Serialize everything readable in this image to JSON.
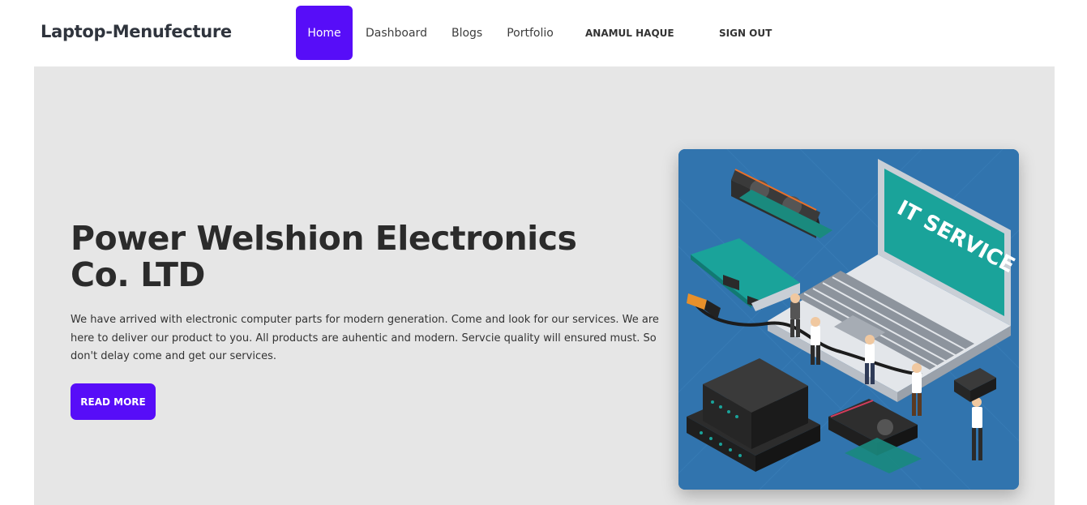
{
  "navbar": {
    "brand": "Laptop-Menufecture",
    "links": [
      {
        "label": "Home"
      },
      {
        "label": "Dashboard"
      },
      {
        "label": "Blogs"
      },
      {
        "label": "Portfolio"
      }
    ],
    "user_name": "ANAMUL HAQUE",
    "signout_label": "SIGN OUT"
  },
  "hero": {
    "title": "Power Welshion Electronics Co. LTD",
    "description": "We have arrived with electronic computer parts for modern generation. Come and look for our services. We are here to deliver our product to you. All products are auhentic and modern. Servcie quality will ensured must. So don't delay come and get our services.",
    "button_label": "READ MORE",
    "image_text": "IT SERVICE"
  },
  "colors": {
    "accent": "#570df8",
    "hero_bg": "#e6e6e6",
    "image_bg": "#3174ae"
  }
}
